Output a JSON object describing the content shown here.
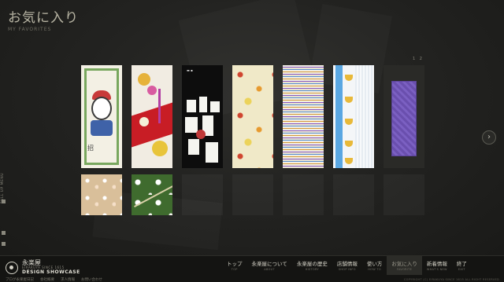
{
  "page": {
    "title_jp": "お気に入り",
    "title_en": "MY FAVORITES"
  },
  "side_rail": {
    "label": "PULL UP MENU"
  },
  "pager": {
    "prev_label": "1",
    "next_label": "2"
  },
  "next_button": {
    "glyph": "›"
  },
  "favorites": {
    "tall_items": [
      {
        "pattern": "cat-doll",
        "caption": "招"
      },
      {
        "pattern": "red-floral"
      },
      {
        "pattern": "black-window",
        "mark": "▬ ▪"
      },
      {
        "pattern": "yellow-floral"
      },
      {
        "pattern": "multicolor-stripes"
      },
      {
        "pattern": "blue-cups"
      },
      {
        "pattern": "purple-cloth"
      }
    ],
    "short_items": [
      {
        "pattern": "sakura-beige"
      },
      {
        "pattern": "white-flowers-green"
      }
    ]
  },
  "footer": {
    "brand_jp": "永楽屋",
    "brand_sub": "EIRAKUYA SINCE 1615",
    "brand_ds": "DESIGN SHOWCASE",
    "nav": [
      {
        "jp": "トップ",
        "en": "TOP"
      },
      {
        "jp": "永楽屋について",
        "en": "ABOUT"
      },
      {
        "jp": "永楽屋の歴史",
        "en": "HISTORY"
      },
      {
        "jp": "店舗情報",
        "en": "SHOP INFO"
      },
      {
        "jp": "使い方",
        "en": "HOW TO"
      },
      {
        "jp": "お気に入り",
        "en": "FAVORITE",
        "active": true
      },
      {
        "jp": "新着情報",
        "en": "WHAT'S NEW"
      },
      {
        "jp": "終了",
        "en": "EXIT"
      }
    ],
    "links": [
      "ブログ永楽屋日記",
      "会社概要",
      "求人情報",
      "お問い合わせ"
    ],
    "copyright": "COPYRIGHT (C) EIRAKUYA SINCE 1615 ALL RIGHT RESERVED"
  },
  "colors": {
    "background": "#1d1d1b",
    "title": "#b8b5a4",
    "active_nav": "#2c2c28"
  }
}
